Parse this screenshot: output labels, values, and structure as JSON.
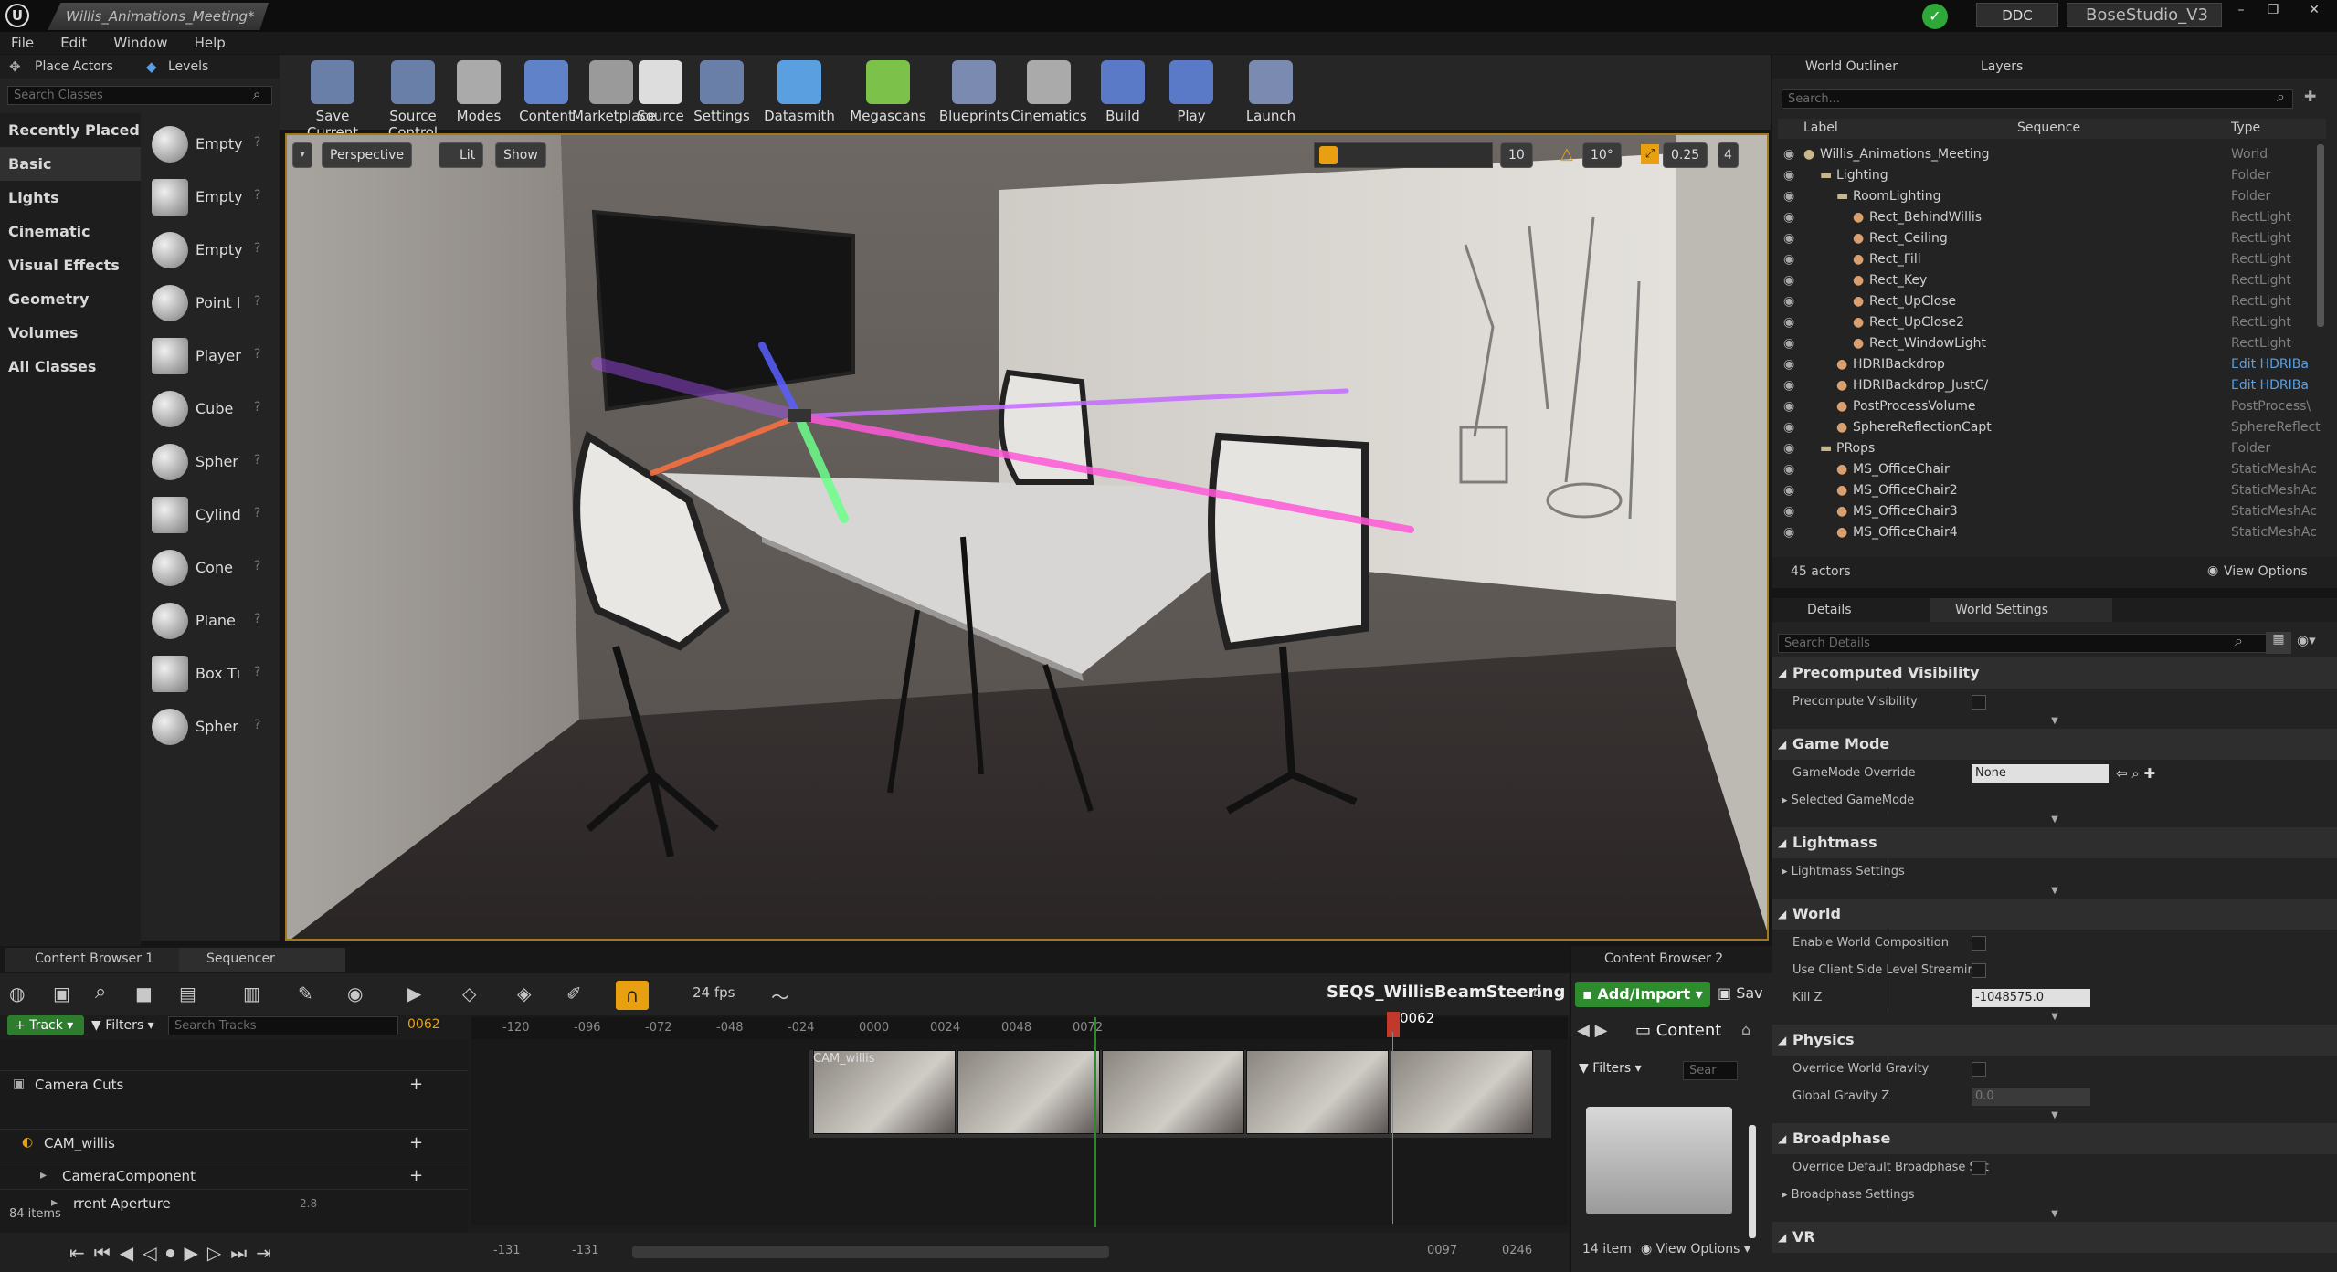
{
  "titlebar": {
    "logo": "U",
    "document_tab": "Willis_Animations_Meeting*",
    "source_control": "DDC",
    "project": "BoseStudio_V3",
    "window_buttons": [
      "–",
      "❐",
      "✕"
    ]
  },
  "menu": [
    "File",
    "Edit",
    "Window",
    "Help"
  ],
  "left_panel": {
    "tabs": [
      "Place Actors",
      "Levels"
    ],
    "search_placeholder": "Search Classes",
    "categories": [
      "Recently Placed",
      "Basic",
      "Lights",
      "Cinematic",
      "Visual Effects",
      "Geometry",
      "Volumes",
      "All Classes"
    ],
    "selected_category": "Basic",
    "items": [
      "Empty",
      "Empty",
      "Empty",
      "Point l",
      "Player",
      "Cube",
      "Spher",
      "Cylind",
      "Cone",
      "Plane",
      "Box Tı",
      "Spher"
    ]
  },
  "toolbar": {
    "buttons": [
      "Save Current",
      "Source Control",
      "Modes",
      "Content",
      "Marketplace",
      "Source",
      "Settings",
      "Datasmith",
      "Megascans",
      "Blueprints",
      "Cinematics",
      "Build",
      "Play",
      "Launch"
    ]
  },
  "viewport": {
    "buttons": [
      "Perspective",
      "Lit",
      "Show"
    ],
    "grid_snap": "10",
    "rot_snap": "10°",
    "scale_snap": "0.25",
    "cam_speed": "4"
  },
  "outliner": {
    "tabs": [
      "World Outliner",
      "Layers"
    ],
    "search_placeholder": "Search...",
    "columns": [
      "Label",
      "Sequence",
      "Type"
    ],
    "rows": [
      {
        "label": "Willis_Animations_Meeting",
        "type": "World",
        "indent": 1
      },
      {
        "label": "Lighting",
        "type": "Folder",
        "indent": 2
      },
      {
        "label": "RoomLighting",
        "type": "Folder",
        "indent": 3
      },
      {
        "label": "Rect_BehindWillis",
        "type": "RectLight",
        "indent": 4
      },
      {
        "label": "Rect_Ceiling",
        "type": "RectLight",
        "indent": 4
      },
      {
        "label": "Rect_Fill",
        "type": "RectLight",
        "indent": 4
      },
      {
        "label": "Rect_Key",
        "type": "RectLight",
        "indent": 4
      },
      {
        "label": "Rect_UpClose",
        "type": "RectLight",
        "indent": 4
      },
      {
        "label": "Rect_UpClose2",
        "type": "RectLight",
        "indent": 4
      },
      {
        "label": "Rect_WindowLight",
        "type": "RectLight",
        "indent": 4
      },
      {
        "label": "HDRIBackdrop",
        "type": "Edit HDRIBa",
        "indent": 3
      },
      {
        "label": "HDRIBackdrop_JustC/",
        "type": "Edit HDRIBa",
        "indent": 3
      },
      {
        "label": "PostProcessVolume",
        "type": "PostProcess\\",
        "indent": 3
      },
      {
        "label": "SphereReflectionCapt",
        "type": "SphereReflect",
        "indent": 3
      },
      {
        "label": "PRops",
        "type": "Folder",
        "indent": 2
      },
      {
        "label": "MS_OfficeChair",
        "type": "StaticMeshAc",
        "indent": 3
      },
      {
        "label": "MS_OfficeChair2",
        "type": "StaticMeshAc",
        "indent": 3
      },
      {
        "label": "MS_OfficeChair3",
        "type": "StaticMeshAc",
        "indent": 3
      },
      {
        "label": "MS_OfficeChair4",
        "type": "StaticMeshAc",
        "indent": 3
      }
    ],
    "count": "45 actors",
    "view_options": "View Options"
  },
  "details": {
    "tabs": [
      "Details",
      "World Settings"
    ],
    "search_placeholder": "Search Details",
    "sections": [
      {
        "title": "Precomputed Visibility",
        "props": [
          {
            "name": "Precompute Visibility",
            "kind": "check"
          }
        ]
      },
      {
        "title": "Game Mode",
        "props": [
          {
            "name": "GameMode Override",
            "kind": "select",
            "value": "None"
          },
          {
            "name": "Selected GameMode",
            "kind": "expander"
          }
        ]
      },
      {
        "title": "Lightmass",
        "props": [
          {
            "name": "Lightmass Settings",
            "kind": "expander"
          }
        ]
      },
      {
        "title": "World",
        "props": [
          {
            "name": "Enable World Composition",
            "kind": "check"
          },
          {
            "name": "Use Client Side Level Streaming",
            "kind": "check"
          },
          {
            "name": "Kill Z",
            "kind": "number",
            "value": "-1048575.0"
          }
        ]
      },
      {
        "title": "Physics",
        "props": [
          {
            "name": "Override World Gravity",
            "kind": "check"
          },
          {
            "name": "Global Gravity Z",
            "kind": "number",
            "value": "0.0"
          }
        ]
      },
      {
        "title": "Broadphase",
        "props": [
          {
            "name": "Override Default Broadphase Set",
            "kind": "check"
          },
          {
            "name": "Broadphase Settings",
            "kind": "expander"
          }
        ]
      },
      {
        "title": "VR",
        "props": []
      }
    ]
  },
  "sequencer": {
    "tabs": [
      "Content Browser 1",
      "Sequencer"
    ],
    "sequence_name": "SEQS_WillisBeamSteering",
    "fps": "24 fps",
    "track_button": "Track",
    "filters": "Filters",
    "search_placeholder": "Search Tracks",
    "current_frame": "0062",
    "ruler": [
      "-120",
      "-096",
      "-072",
      "-048",
      "-024",
      "0000",
      "0024",
      "0048",
      "0072"
    ],
    "tracks": [
      "Camera Cuts",
      "CAM_willis",
      "CameraComponent",
      "rrent Aperture"
    ],
    "aperture_value": "2.8",
    "items_count": "84 items",
    "clip_label": "CAM_willis",
    "range_start": "-131",
    "range_start2": "-131",
    "range_end": "0097",
    "range_end2": "0246"
  },
  "content_browser2": {
    "tab": "Content Browser 2",
    "add_import": "Add/Import",
    "save": "Sav",
    "path": "Content",
    "filters": "Filters",
    "search_placeholder": "Sear",
    "count": "14 item",
    "view_options": "View Options"
  }
}
